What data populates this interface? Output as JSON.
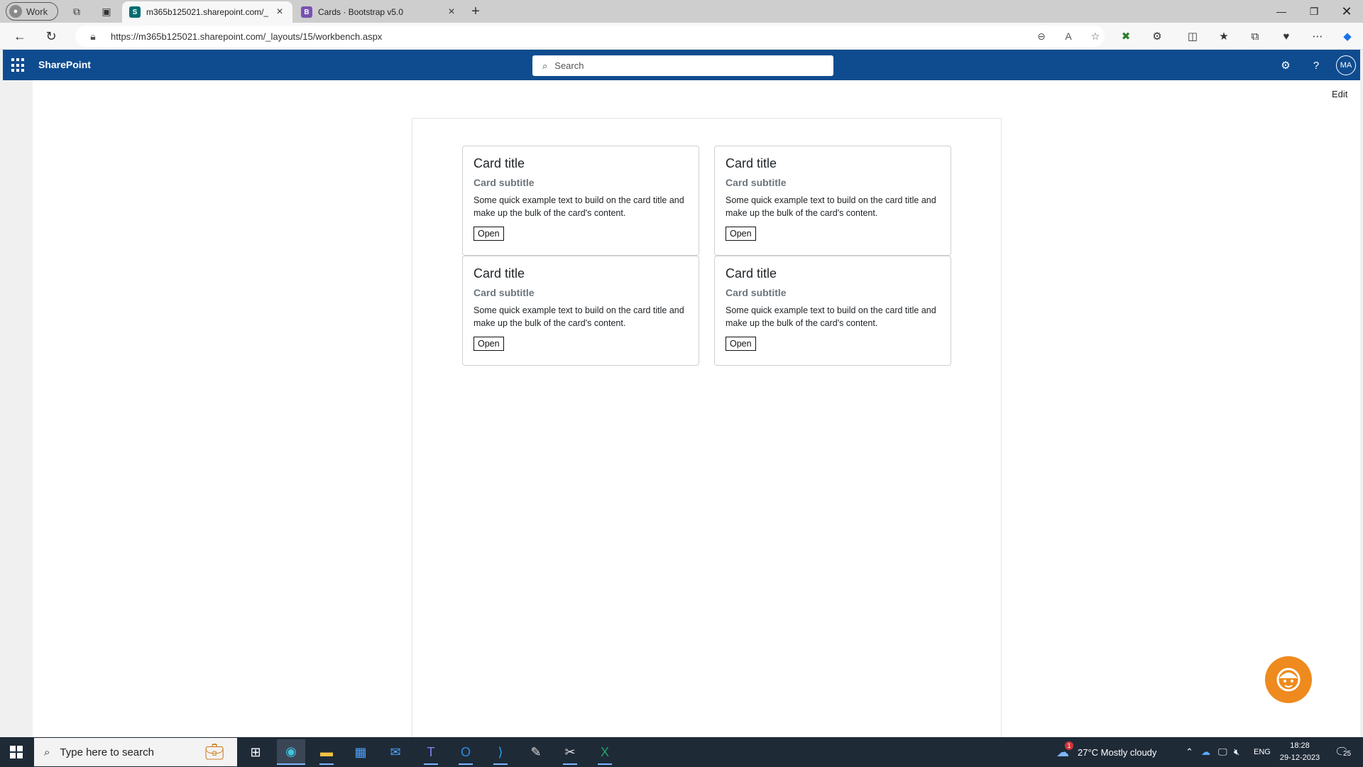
{
  "browser": {
    "profile_label": "Work",
    "tabs": [
      {
        "label": "m365b125021.sharepoint.com/_l",
        "favicon": "S",
        "color": "#036c70"
      },
      {
        "label": "Cards · Bootstrap v5.0",
        "favicon": "B",
        "color": "#7952b3"
      }
    ],
    "url": "https://m365b125021.sharepoint.com/_layouts/15/workbench.aspx"
  },
  "suite_bar": {
    "brand": "SharePoint",
    "search_placeholder": "Search",
    "user_initials": "MA",
    "color": "#0f4c8f"
  },
  "page": {
    "edit_label": "Edit",
    "cards": [
      {
        "title": "Card title",
        "subtitle": "Card subtitle",
        "text": "Some quick example text to build on the card title and make up the bulk of the card's content.",
        "button": "Open"
      },
      {
        "title": "Card title",
        "subtitle": "Card subtitle",
        "text": "Some quick example text to build on the card title and make up the bulk of the card's content.",
        "button": "Open"
      },
      {
        "title": "Card title",
        "subtitle": "Card subtitle",
        "text": "Some quick example text to build on the card title and make up the bulk of the card's content.",
        "button": "Open"
      },
      {
        "title": "Card title",
        "subtitle": "Card subtitle",
        "text": "Some quick example text to build on the card title and make up the bulk of the card's content.",
        "button": "Open"
      }
    ]
  },
  "taskbar": {
    "search_placeholder": "Type here to search",
    "weather": "27°C  Mostly cloudy",
    "language": "ENG",
    "time": "18:28",
    "date": "29-12-2023",
    "notification_count": "25",
    "weather_badge": "1"
  }
}
